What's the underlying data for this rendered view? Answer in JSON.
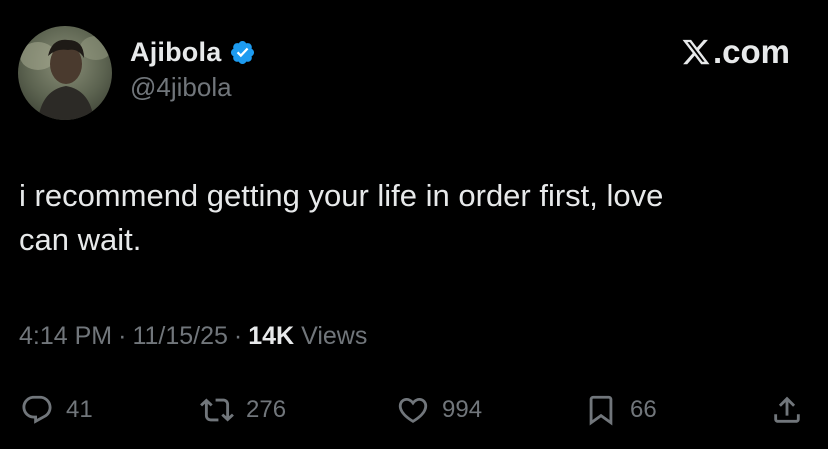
{
  "author": {
    "display_name": "Ajibola",
    "handle": "@4jibola",
    "verified": true
  },
  "brand": {
    "label": ".com",
    "icon": "x-logo-icon"
  },
  "tweet": {
    "text": "i recommend getting your life in order first, love\ncan wait.",
    "time": "4:14 PM",
    "date": "11/15/25",
    "separator": "·",
    "views_count": "14K",
    "views_label": "Views"
  },
  "actions": {
    "replies": "41",
    "reposts": "276",
    "likes": "994",
    "bookmarks": "66"
  },
  "colors": {
    "background": "#000000",
    "text_primary": "#e7e9ea",
    "text_secondary": "#71767b",
    "verified_badge": "#1d9bf0"
  }
}
